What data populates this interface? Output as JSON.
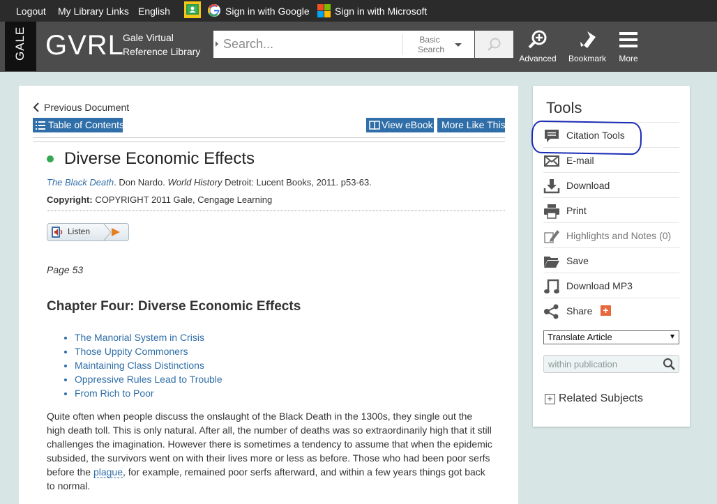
{
  "topbar": {
    "logout": "Logout",
    "library_links": "My Library Links",
    "language": "English",
    "google_signin": "Sign in with Google",
    "microsoft_signin": "Sign in with Microsoft"
  },
  "header": {
    "gale_tab": "GALE",
    "logo": "GVRL",
    "logo_sub_line1": "Gale Virtual",
    "logo_sub_line2": "Reference Library",
    "search_placeholder": "Search...",
    "search_mode_line1": "Basic",
    "search_mode_line2": "Search",
    "advanced": "Advanced",
    "bookmark": "Bookmark",
    "more": "More"
  },
  "document": {
    "previous_document": "Previous Document",
    "table_of_contents": "Table of Contents",
    "view_ebook": "View eBook",
    "more_like_this": "More Like This",
    "title": "Diverse Economic Effects",
    "citation": {
      "source_title": "The Black Death",
      "author": ". Don Nardo. ",
      "series": "World History",
      "rest": " Detroit: Lucent Books, 2011. p53-63."
    },
    "copyright_label": "Copyright:",
    "copyright_text": " COPYRIGHT 2011 Gale, Cengage Learning",
    "listen": "Listen",
    "page_label": "Page 53",
    "chapter_heading": "Chapter Four: Diverse Economic Effects",
    "toc_items": [
      "The Manorial System in Crisis",
      "Those Uppity Commoners",
      "Maintaining Class Distinctions",
      "Oppressive Rules Lead to Trouble",
      "From Rich to Poor"
    ],
    "body_part1": "Quite often when people discuss the onslaught of the Black Death in the 1300s, they single out the high death toll. This is only natural. After all, the number of deaths was so extraordinarily high that it still challenges the imagination. However there is sometimes a tendency to assume that when the epidemic subsided, the survivors went on with their lives more or less as before. Those who had been poor serfs before the ",
    "body_link": "plague",
    "body_part2": ", for example, remained poor serfs afterward, and within a few years things got back to normal."
  },
  "tools": {
    "title": "Tools",
    "items": [
      {
        "label": "Citation Tools",
        "icon": "speech-bubble-icon"
      },
      {
        "label": "E-mail",
        "icon": "envelope-icon"
      },
      {
        "label": "Download",
        "icon": "download-icon"
      },
      {
        "label": "Print",
        "icon": "printer-icon"
      },
      {
        "label": "Highlights and Notes (0)",
        "icon": "pencil-icon"
      },
      {
        "label": "Save",
        "icon": "folder-icon"
      },
      {
        "label": "Download MP3",
        "icon": "music-note-icon"
      },
      {
        "label": "Share",
        "icon": "share-icon"
      }
    ],
    "translate": "Translate Article",
    "within_placeholder": "within publication",
    "related_subjects": "Related Subjects"
  },
  "colors": {
    "link_blue": "#2f6ea8",
    "header_gray": "#4c4c4c",
    "topbar": "#2b2b2b",
    "background": "#d7e5e4",
    "annotation_circle": "#1a2bb5"
  }
}
